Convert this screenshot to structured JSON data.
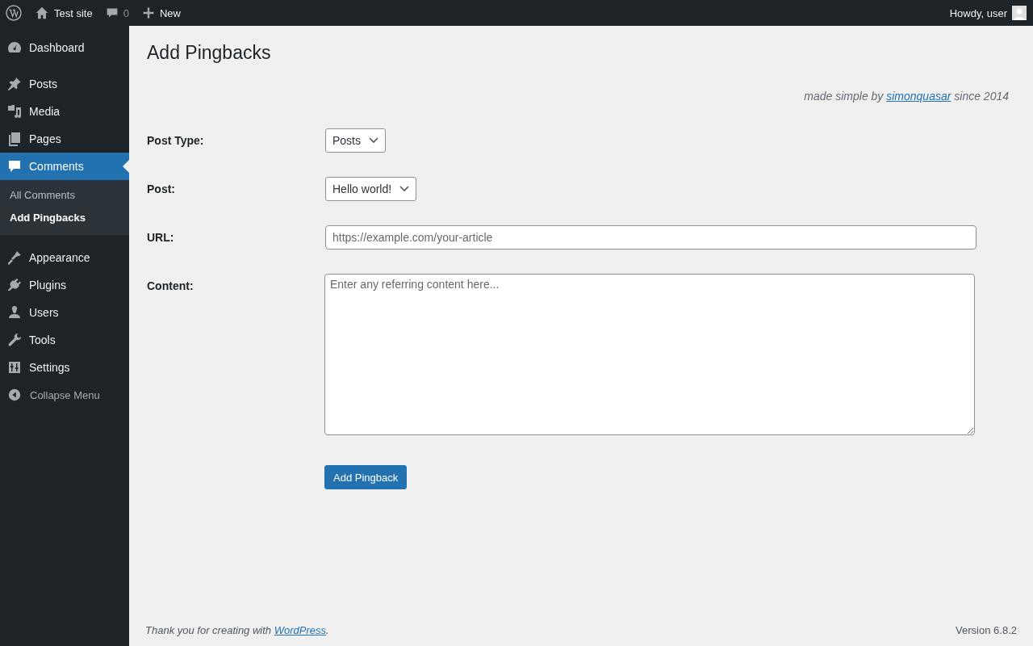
{
  "admin_bar": {
    "site_name": "Test site",
    "comments_count": "0",
    "new_label": "New",
    "greeting": "Howdy, user"
  },
  "sidebar": {
    "items": [
      {
        "kind": "dashboard",
        "label": "Dashboard",
        "selected": false
      },
      {
        "kind": "posts",
        "label": "Posts",
        "selected": false
      },
      {
        "kind": "media",
        "label": "Media",
        "selected": false
      },
      {
        "kind": "pages",
        "label": "Pages",
        "selected": false
      },
      {
        "kind": "comments",
        "label": "Comments",
        "selected": true,
        "children": [
          {
            "label": "All Comments",
            "selected": false
          },
          {
            "label": "Add Pingbacks",
            "selected": true
          }
        ]
      },
      {
        "kind": "appearance",
        "label": "Appearance",
        "selected": false
      },
      {
        "kind": "plugins",
        "label": "Plugins",
        "selected": false
      },
      {
        "kind": "users",
        "label": "Users",
        "selected": false
      },
      {
        "kind": "tools",
        "label": "Tools",
        "selected": false
      },
      {
        "kind": "settings",
        "label": "Settings",
        "selected": false
      }
    ],
    "collapse_label": "Collapse Menu"
  },
  "page": {
    "title": "Add Pingbacks",
    "credit": {
      "before": "made simple by",
      "link": "simonquasar",
      "after": "since 2014"
    },
    "fields": [
      {
        "kind": "select",
        "label": "Post Type:",
        "value": "Posts"
      },
      {
        "kind": "select",
        "label": "Post:",
        "value": "Hello world!"
      },
      {
        "kind": "input",
        "label": "URL:",
        "placeholder": "https://example.com/your-article"
      },
      {
        "kind": "textarea",
        "label": "Content:",
        "placeholder": "Enter any referring content here..."
      }
    ],
    "submit": "Add Pingback"
  },
  "footer": {
    "before": "Thank you for creating with",
    "link": "WordPress",
    "after": ".",
    "version": "Version 6.8.2"
  }
}
